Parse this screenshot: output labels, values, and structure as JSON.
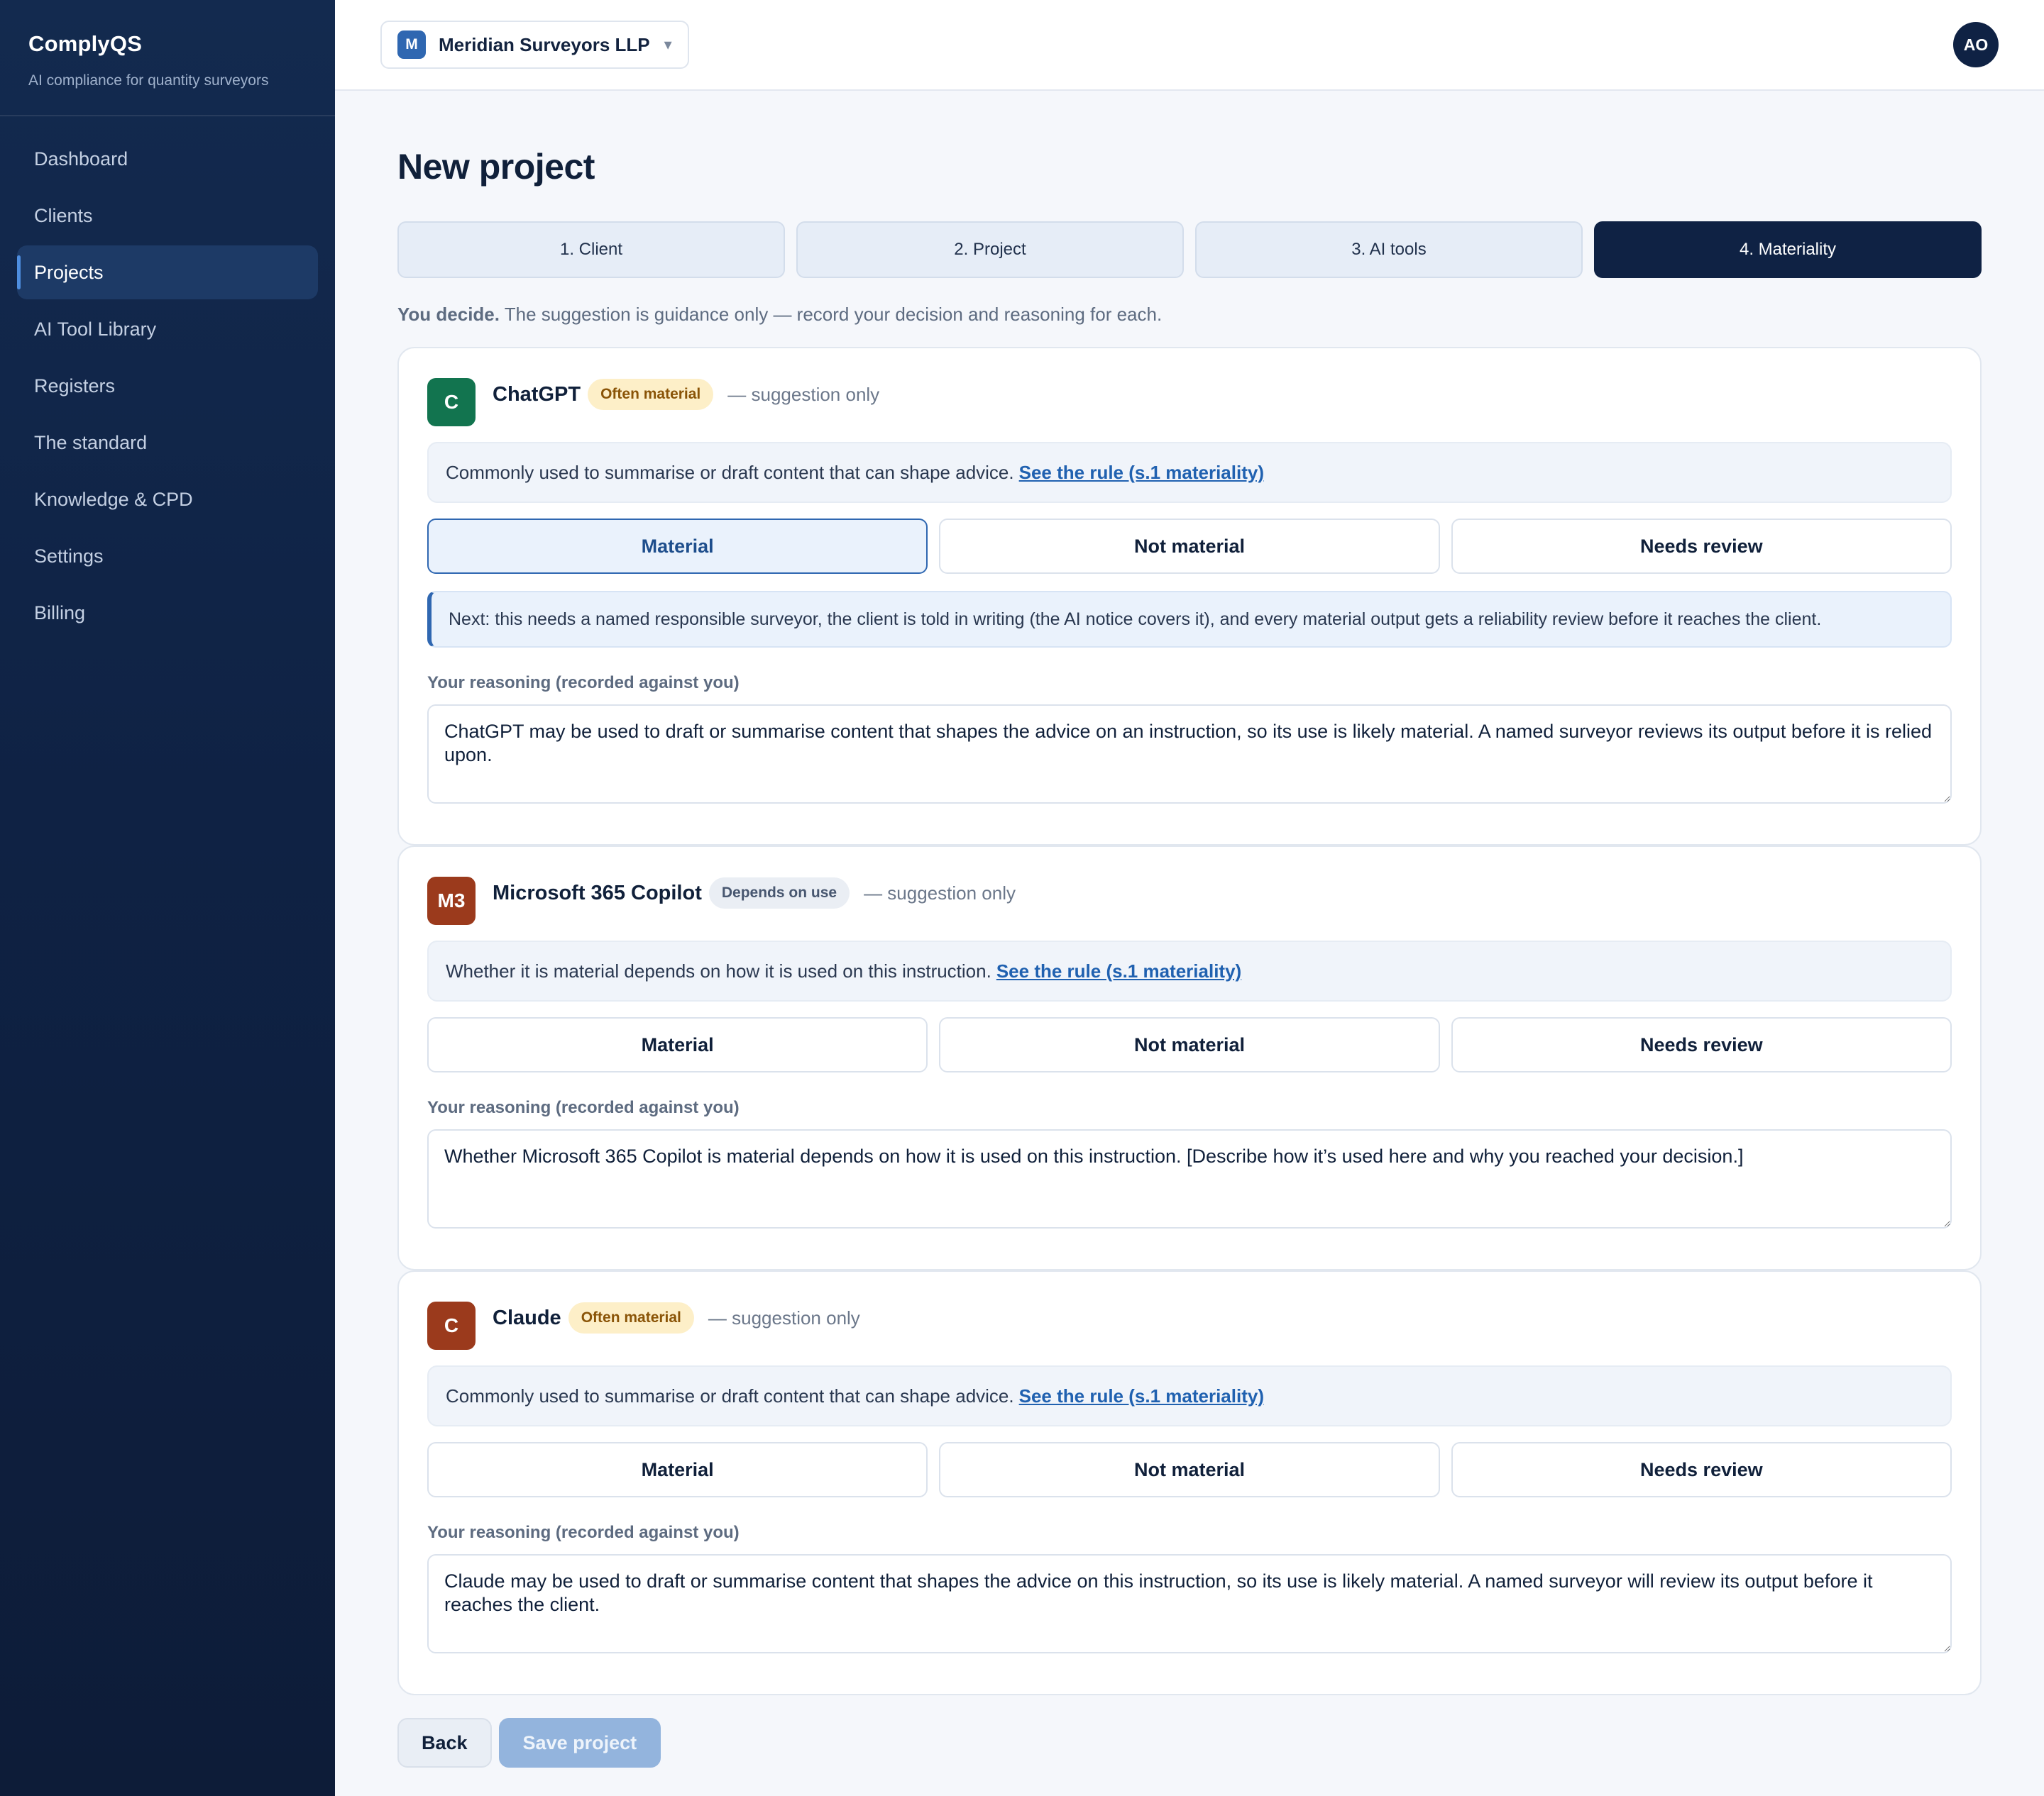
{
  "brand": {
    "name": "ComplyQS",
    "tagline": "AI compliance for quantity surveyors"
  },
  "sidebar": {
    "items": [
      {
        "label": "Dashboard",
        "active": false
      },
      {
        "label": "Clients",
        "active": false
      },
      {
        "label": "Projects",
        "active": true
      },
      {
        "label": "AI Tool Library",
        "active": false
      },
      {
        "label": "Registers",
        "active": false
      },
      {
        "label": "The standard",
        "active": false
      },
      {
        "label": "Knowledge & CPD",
        "active": false
      },
      {
        "label": "Settings",
        "active": false
      },
      {
        "label": "Billing",
        "active": false
      }
    ]
  },
  "topbar": {
    "org_initial": "M",
    "org_name": "Meridian Surveyors LLP",
    "org_caret": "▾",
    "avatar_initials": "AO"
  },
  "page": {
    "title": "New project",
    "steps": [
      {
        "label": "1. Client",
        "active": false
      },
      {
        "label": "2. Project",
        "active": false
      },
      {
        "label": "3. AI tools",
        "active": false
      },
      {
        "label": "4. Materiality",
        "active": true
      }
    ],
    "hint_bold": "You decide.",
    "hint_rest": " The suggestion is guidance only — record your decision and reasoning for each."
  },
  "tools": [
    {
      "initials": "C",
      "icon_color": "#12744f",
      "name": "ChatGPT",
      "badge": "Often material",
      "badge_kind": "often",
      "suggestion": "— suggestion only",
      "info": "Commonly used to summarise or draft content that can shape advice.",
      "link": "See the rule (s.1 materiality)",
      "choices": [
        "Material",
        "Not material",
        "Needs review"
      ],
      "selected": "Material",
      "next_note": "Next: this needs a named responsible surveyor, the client is told in writing (the AI notice covers it), and every material output gets a reliability review before it reaches the client.",
      "reason_label": "Your reasoning (recorded against you)",
      "reasoning": "ChatGPT may be used to draft or summarise content that shapes the advice on an instruction, so its use is likely material. A named surveyor reviews its output before it is relied upon."
    },
    {
      "initials": "M3",
      "icon_color": "#9b3a1c",
      "name": "Microsoft 365 Copilot",
      "badge": "Depends on use",
      "badge_kind": "depends",
      "suggestion": "— suggestion only",
      "info": "Whether it is material depends on how it is used on this instruction.",
      "link": "See the rule (s.1 materiality)",
      "choices": [
        "Material",
        "Not material",
        "Needs review"
      ],
      "selected": "",
      "next_note": "",
      "reason_label": "Your reasoning (recorded against you)",
      "reasoning": "Whether Microsoft 365 Copilot is material depends on how it is used on this instruction. [Describe how it’s used here and why you reached your decision.]"
    },
    {
      "initials": "C",
      "icon_color": "#9b3a1c",
      "name": "Claude",
      "badge": "Often material",
      "badge_kind": "often",
      "suggestion": "— suggestion only",
      "info": "Commonly used to summarise or draft content that can shape advice.",
      "link": "See the rule (s.1 materiality)",
      "choices": [
        "Material",
        "Not material",
        "Needs review"
      ],
      "selected": "",
      "next_note": "",
      "reason_label": "Your reasoning (recorded against you)",
      "reasoning": "Claude may be used to draft or summarise content that shapes the advice on this instruction, so its use is likely material. A named surveyor will review its output before it reaches the client."
    }
  ],
  "actions": {
    "back_label": "Back",
    "save_label": "Save project"
  }
}
